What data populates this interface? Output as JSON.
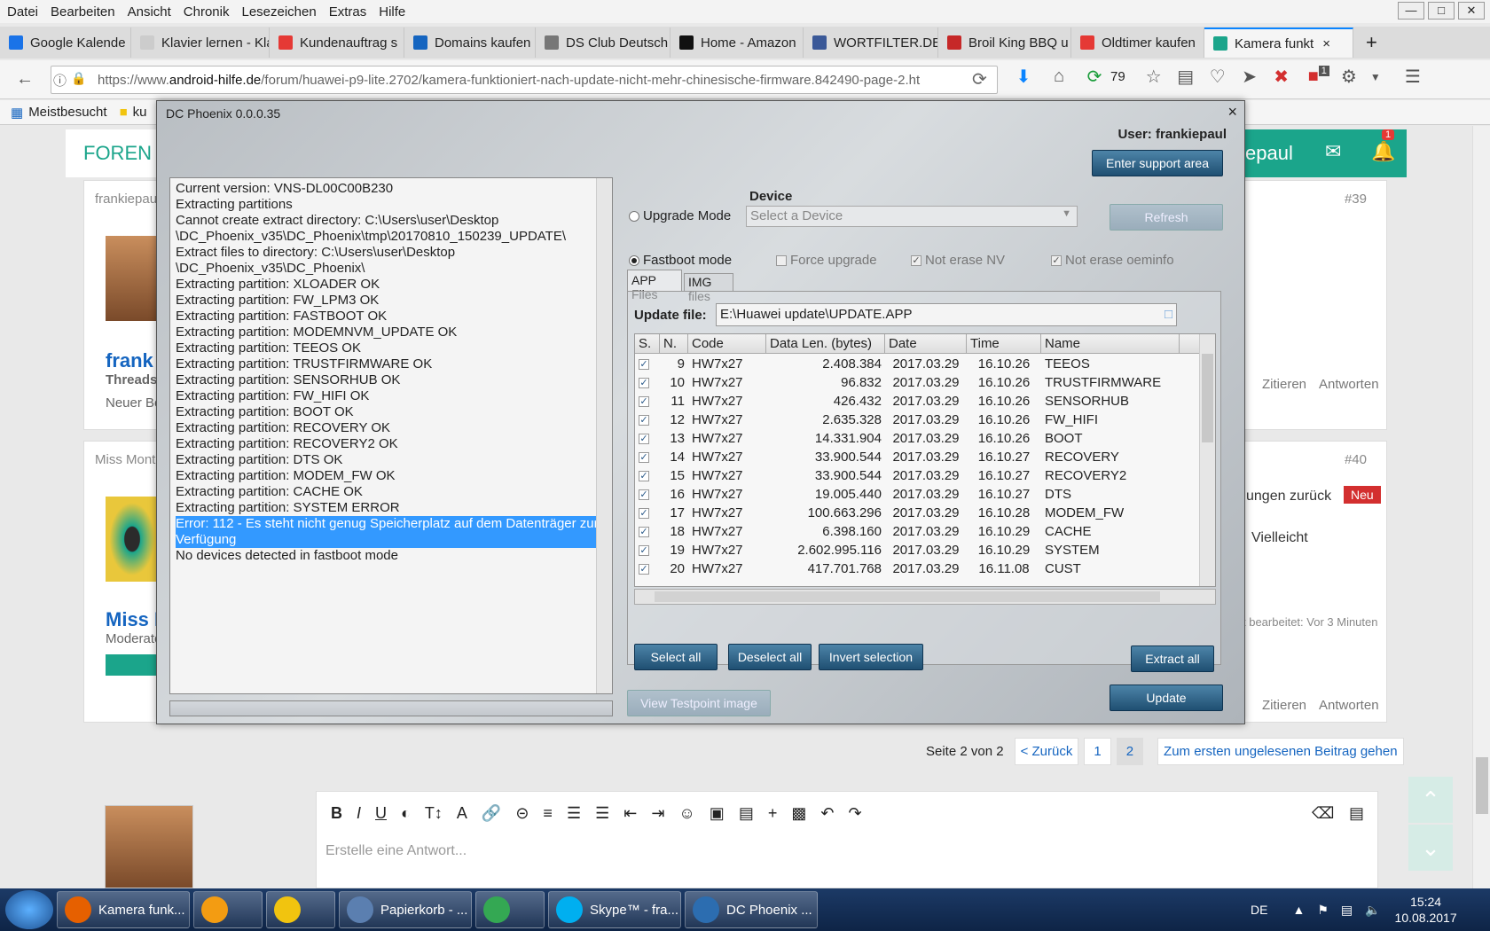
{
  "menu": [
    "Datei",
    "Bearbeiten",
    "Ansicht",
    "Chronik",
    "Lesezeichen",
    "Extras",
    "Hilfe"
  ],
  "tabs": [
    {
      "label": "Google Kalende",
      "color": "#1a73e8",
      "icon": "calendar-icon"
    },
    {
      "label": "Klavier lernen - Klavi",
      "color": "#cccccc",
      "icon": "page-icon"
    },
    {
      "label": "Kundenauftrag s",
      "color": "#e53935",
      "icon": "order-icon"
    },
    {
      "label": "Domains kaufen",
      "color": "#1565c0",
      "icon": "s-logo-icon"
    },
    {
      "label": "DS Club Deutsch",
      "color": "#777777",
      "icon": "club-icon"
    },
    {
      "label": "Home - Amazon",
      "color": "#111111",
      "icon": "amazon-icon"
    },
    {
      "label": "WORTFILTER.DE",
      "color": "#3b5998",
      "icon": "facebook-icon"
    },
    {
      "label": "Broil King BBQ u",
      "color": "#c62828",
      "icon": "star-icon"
    },
    {
      "label": "Oldtimer kaufen",
      "color": "#e53935",
      "icon": "m-logo-icon"
    },
    {
      "label": "Kamera funkt",
      "color": "#1ba58b",
      "icon": "android-hilfe-icon"
    }
  ],
  "url": {
    "prefix": "https://www.",
    "domain": "android-hilfe.de",
    "rest": "/forum/huawei-p9-lite.2702/kamera-funktioniert-nach-update-nicht-mehr-chinesische-firmware.842490-page-2.ht"
  },
  "toolbar": {
    "counter": "79",
    "badge": "1"
  },
  "bookmarks": [
    "Meistbesucht",
    "ku"
  ],
  "forum": {
    "title": "FOREN",
    "user_partial": "epaul",
    "bell_badge": "1",
    "post1": {
      "author": "frankiepau",
      "num": "#39",
      "name": "frank",
      "role": "Threads",
      "sub": "Neuer Be",
      "quote": "Zitieren",
      "reply": "Antworten"
    },
    "post2": {
      "author": "Miss Mont",
      "num": "#40",
      "text1": "ungen zurück",
      "badge": "Neu",
      "text2": "Vielleicht",
      "edited": "t bearbeitet: Vor 3 Minuten",
      "name": "Miss M",
      "role": "Moderato",
      "quote": "Zitieren",
      "reply": "Antworten"
    },
    "pagination": {
      "label": "Seite 2 von 2",
      "back": "< Zurück",
      "p1": "1",
      "p2": "2",
      "first_unread": "Zum ersten ungelesenen Beitrag gehen"
    },
    "editor_placeholder": "Erstelle eine Antwort..."
  },
  "dialog": {
    "title": "DC Phoenix 0.0.0.35",
    "user": "User: frankiepaul",
    "support": "Enter support area",
    "device_label": "Device",
    "upgrade_mode": "Upgrade Mode",
    "device_placeholder": "Select a Device",
    "refresh": "Refresh",
    "fastboot_mode": "Fastboot mode",
    "force_upgrade": "Force upgrade",
    "not_erase_nv": "Not erase NV",
    "not_erase_oeminfo": "Not erase oeminfo",
    "tab_app": "APP Files",
    "tab_img": "IMG files",
    "update_file_label": "Update file:",
    "update_file": "E:\\Huawei update\\UPDATE.APP",
    "columns": [
      "S.",
      "N.",
      "Code",
      "Data Len. (bytes)",
      "Date",
      "Time",
      "Name"
    ],
    "rows": [
      [
        "9",
        "HW7x27",
        "2.408.384",
        "2017.03.29",
        "16.10.26",
        "TEEOS"
      ],
      [
        "10",
        "HW7x27",
        "96.832",
        "2017.03.29",
        "16.10.26",
        "TRUSTFIRMWARE"
      ],
      [
        "11",
        "HW7x27",
        "426.432",
        "2017.03.29",
        "16.10.26",
        "SENSORHUB"
      ],
      [
        "12",
        "HW7x27",
        "2.635.328",
        "2017.03.29",
        "16.10.26",
        "FW_HIFI"
      ],
      [
        "13",
        "HW7x27",
        "14.331.904",
        "2017.03.29",
        "16.10.26",
        "BOOT"
      ],
      [
        "14",
        "HW7x27",
        "33.900.544",
        "2017.03.29",
        "16.10.27",
        "RECOVERY"
      ],
      [
        "15",
        "HW7x27",
        "33.900.544",
        "2017.03.29",
        "16.10.27",
        "RECOVERY2"
      ],
      [
        "16",
        "HW7x27",
        "19.005.440",
        "2017.03.29",
        "16.10.27",
        "DTS"
      ],
      [
        "17",
        "HW7x27",
        "100.663.296",
        "2017.03.29",
        "16.10.28",
        "MODEM_FW"
      ],
      [
        "18",
        "HW7x27",
        "6.398.160",
        "2017.03.29",
        "16.10.29",
        "CACHE"
      ],
      [
        "19",
        "HW7x27",
        "2.602.995.116",
        "2017.03.29",
        "16.10.29",
        "SYSTEM"
      ],
      [
        "20",
        "HW7x27",
        "417.701.768",
        "2017.03.29",
        "16.11.08",
        "CUST"
      ]
    ],
    "select_all": "Select all",
    "deselect_all": "Deselect all",
    "invert_selection": "Invert selection",
    "extract_all": "Extract all",
    "view_testpoint": "View Testpoint image",
    "update": "Update",
    "log": [
      "Current version: VNS-DL00C00B230",
      "Extracting partitions",
      "Cannot create extract directory: C:\\Users\\user\\Desktop",
      "\\DC_Phoenix_v35\\DC_Phoenix\\tmp\\20170810_150239_UPDATE\\",
      "Extract files to directory: C:\\Users\\user\\Desktop",
      "\\DC_Phoenix_v35\\DC_Phoenix\\",
      "Extracting partition: XLOADER OK",
      "Extracting partition: FW_LPM3 OK",
      "Extracting partition: FASTBOOT OK",
      "Extracting partition: MODEMNVM_UPDATE OK",
      "Extracting partition: TEEOS OK",
      "Extracting partition: TRUSTFIRMWARE OK",
      "Extracting partition: SENSORHUB OK",
      "Extracting partition: FW_HIFI OK",
      "Extracting partition: BOOT OK",
      "Extracting partition: RECOVERY OK",
      "Extracting partition: RECOVERY2 OK",
      "Extracting partition: DTS OK",
      "Extracting partition: MODEM_FW OK",
      "Extracting partition: CACHE OK",
      "Extracting partition: SYSTEM ERROR"
    ],
    "log_error": "Error: 112 - Es steht nicht genug Speicherplatz auf dem Datenträger zur Verfügung",
    "log_last": "No devices detected in fastboot mode"
  },
  "taskbar": [
    {
      "label": "Kamera funk...",
      "color": "#e66000"
    },
    {
      "label": "",
      "color": "#f39c12"
    },
    {
      "label": "",
      "color": "#f1c40f"
    },
    {
      "label": "Papierkorb - ...",
      "color": "#5b7fb0"
    },
    {
      "label": "",
      "color": "#34a853"
    },
    {
      "label": "Skype™ - fra...",
      "color": "#00aff0"
    },
    {
      "label": "DC Phoenix ...",
      "color": "#2c6db0"
    }
  ],
  "tray": {
    "lang": "DE",
    "time": "15:24",
    "date": "10.08.2017"
  }
}
